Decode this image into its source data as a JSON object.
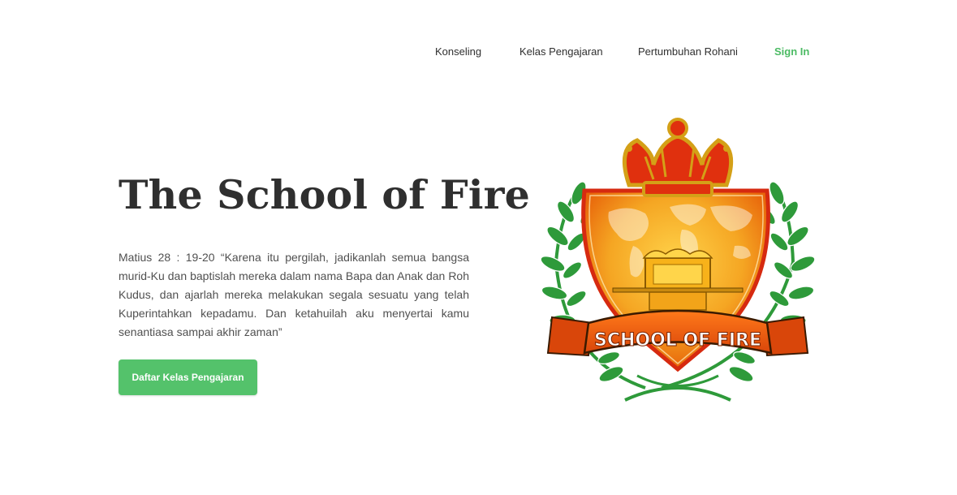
{
  "nav": {
    "items": [
      {
        "label": "Konseling"
      },
      {
        "label": "Kelas Pengajaran"
      },
      {
        "label": "Pertumbuhan Rohani"
      }
    ],
    "signin_label": "Sign In"
  },
  "hero": {
    "title": "The School of Fire",
    "verse": "Matius 28 : 19-20 “Karena itu pergilah, jadikanlah semua bangsa murid-Ku dan baptislah mereka dalam nama Bapa dan Anak dan Roh Kudus, dan ajarlah mereka melakukan segala sesuatu yang telah Kuperintahkan kepadamu. Dan ketahuilah aku menyertai kamu senantiasa sampai akhir zaman”",
    "cta_label": "Daftar Kelas Pengajaran"
  },
  "logo": {
    "banner_text": "SCHOOL OF FIRE"
  },
  "colors": {
    "accent": "#54c26b",
    "signin": "#4cbb64",
    "shield_orange": "#f08a10",
    "crown_red": "#e0300e",
    "laurel_green": "#2e9a3a"
  }
}
